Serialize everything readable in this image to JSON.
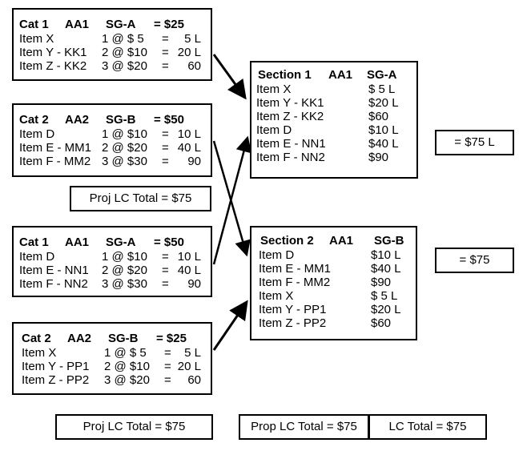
{
  "categories": [
    {
      "cat": "Cat 1",
      "aa": "AA1",
      "sg": "SG-A",
      "total": "=  $25",
      "items": [
        {
          "name": "Item X",
          "calc": "1 @ $ 5",
          "eq": "=",
          "value": "5 L"
        },
        {
          "name": "Item Y - KK1",
          "calc": "2 @ $10",
          "eq": "=",
          "value": "20 L"
        },
        {
          "name": "Item Z - KK2",
          "calc": "3 @ $20",
          "eq": "=",
          "value": "60"
        }
      ]
    },
    {
      "cat": "Cat 2",
      "aa": "AA2",
      "sg": "SG-B",
      "total": "=  $50",
      "items": [
        {
          "name": "Item D",
          "calc": "1 @ $10",
          "eq": "=",
          "value": "10 L"
        },
        {
          "name": "Item E - MM1",
          "calc": "2 @ $20",
          "eq": "=",
          "value": "40 L"
        },
        {
          "name": "Item F - MM2",
          "calc": "3 @ $30",
          "eq": "=",
          "value": "90"
        }
      ]
    },
    {
      "cat": "Cat 1",
      "aa": "AA1",
      "sg": "SG-A",
      "total": "=  $50",
      "items": [
        {
          "name": "Item D",
          "calc": "1 @ $10",
          "eq": "=",
          "value": "10 L"
        },
        {
          "name": "Item E - NN1",
          "calc": "2 @ $20",
          "eq": "=",
          "value": "40 L"
        },
        {
          "name": "Item F - NN2",
          "calc": "3 @ $30",
          "eq": "=",
          "value": "90"
        }
      ]
    },
    {
      "cat": "Cat 2",
      "aa": "AA2",
      "sg": "SG-B",
      "total": "=  $25",
      "items": [
        {
          "name": "Item X",
          "calc": "1 @ $ 5",
          "eq": "=",
          "value": "5 L"
        },
        {
          "name": "Item Y - PP1",
          "calc": "2 @ $10",
          "eq": "=",
          "value": "20 L"
        },
        {
          "name": "Item Z - PP2",
          "calc": "3 @ $20",
          "eq": "=",
          "value": "60"
        }
      ]
    }
  ],
  "sections": [
    {
      "title": "Section 1",
      "aa": "AA1",
      "sg": "SG-A",
      "items": [
        {
          "name": "Item X",
          "value": "$ 5 L"
        },
        {
          "name": "Item Y - KK1",
          "value": "$20 L"
        },
        {
          "name": "Item Z - KK2",
          "value": "$60"
        },
        {
          "name": "Item D",
          "value": "$10 L"
        },
        {
          "name": "Item E - NN1",
          "value": "$40 L"
        },
        {
          "name": "Item F - NN2",
          "value": "$90"
        }
      ],
      "total": "= $75 L"
    },
    {
      "title": "Section 2",
      "aa": "AA1",
      "sg": "SG-B",
      "items": [
        {
          "name": "Item D",
          "value": "$10 L"
        },
        {
          "name": "Item E - MM1",
          "value": "$40 L"
        },
        {
          "name": "Item F - MM2",
          "value": "$90"
        },
        {
          "name": "Item X",
          "value": "$ 5 L"
        },
        {
          "name": "Item Y - PP1",
          "value": "$20 L"
        },
        {
          "name": "Item Z - PP2",
          "value": "$60"
        }
      ],
      "total": "= $75"
    }
  ],
  "totals": {
    "proj_lc_top": "Proj LC Total  = $75",
    "proj_lc_bottom": "Proj LC Total  = $75",
    "prop_lc": "Prop LC Total  = $75",
    "lc": "LC Total  = $75"
  }
}
